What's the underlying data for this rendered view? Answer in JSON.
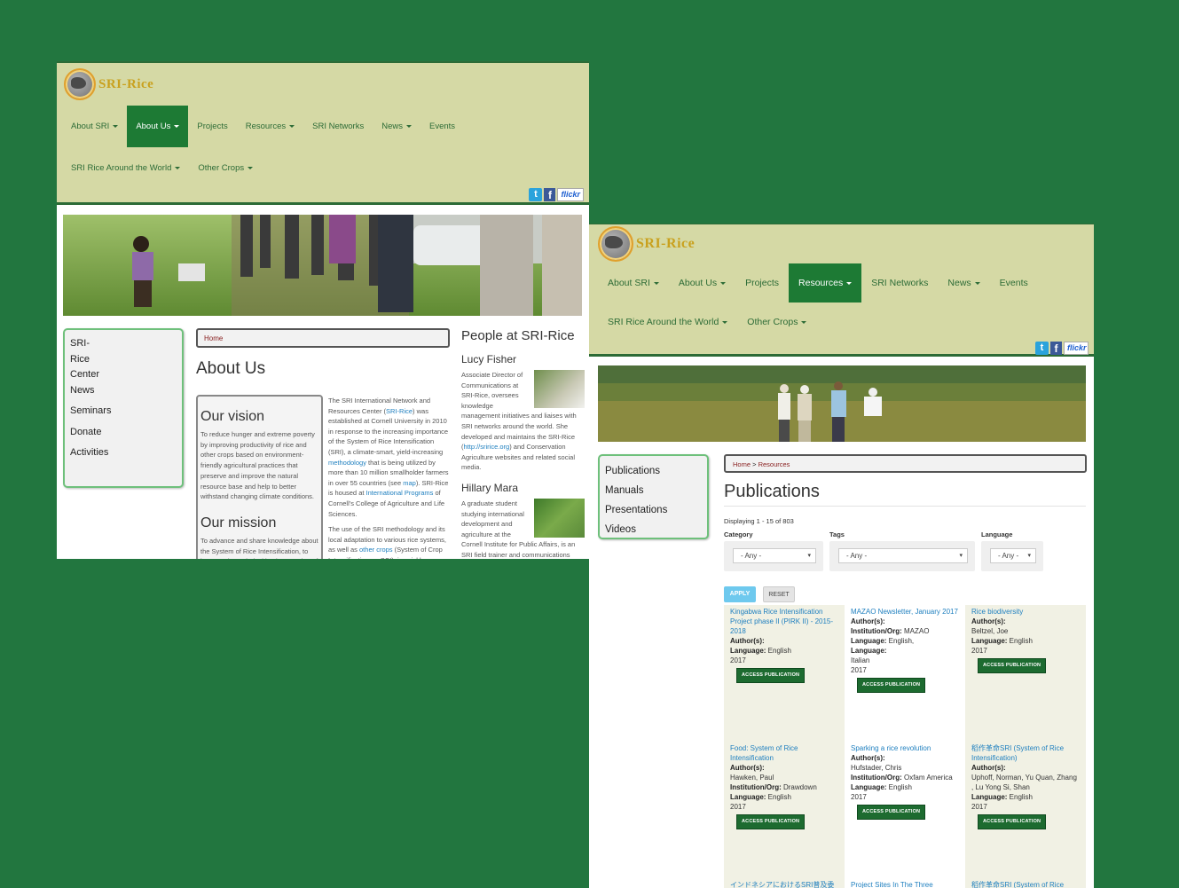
{
  "shotA": {
    "logo": "SRI-Rice",
    "nav": [
      {
        "label": "About SRI",
        "caret": true,
        "active": false
      },
      {
        "label": "About Us",
        "caret": true,
        "active": true
      },
      {
        "label": "Projects",
        "caret": false,
        "active": false
      },
      {
        "label": "Resources",
        "caret": true,
        "active": false
      },
      {
        "label": "SRI Networks",
        "caret": false,
        "active": false
      },
      {
        "label": "News",
        "caret": true,
        "active": false
      },
      {
        "label": "Events",
        "caret": false,
        "active": false
      },
      {
        "label": "SRI Rice Around the World",
        "caret": true,
        "active": false
      },
      {
        "label": "Other Crops",
        "caret": true,
        "active": false
      }
    ],
    "social": {
      "twitter": "t",
      "facebook": "f",
      "flickr": "flickr"
    },
    "sidebar": [
      "SRI-",
      "Rice",
      "Center",
      "News",
      "Seminars",
      "Donate",
      "Activities"
    ],
    "breadcrumb": "Home",
    "title": "About Us",
    "vision": {
      "heading": "Our vision",
      "text": "To reduce hunger and extreme poverty by improving productivity of rice and other crops based on environment-friendly agricultural practices that preserve and improve the natural resource base and help to better withstand changing climate conditions."
    },
    "mission": {
      "heading": "Our mission",
      "text": "To advance and share knowledge about the System of Rice Intensification, to improve the technical implementation of the SRI"
    },
    "intro": {
      "p1a": "The SRI International Network and Resources Center (",
      "p1link1": "SRI-Rice",
      "p1b": ") was established at Cornell University in 2010 in response to the increasing importance of the System of Rice Intensification (SRI), a climate-smart, yield-increasing ",
      "p1link2": "methodology",
      "p1c": " that is being utilized by more than 10 million smallholder farmers in over 55 countries (see ",
      "p1link3": "map",
      "p1d": "). SRI-Rice is housed at ",
      "p1link4": "International Programs",
      "p1e": " of Cornell's College of Agriculture and Life Sciences.",
      "p2a": "The use of the SRI methodology and its local adaptation to various rice systems, as well as ",
      "p2link": "other crops",
      "p2b": " (System of Crop Intensification, or SCI), is quickly spreading among resource-limited farmers in Asia, Africa and Latin"
    },
    "people": {
      "heading": "People at SRI-Rice",
      "p1name": "Lucy Fisher",
      "p1a": "Associate Director of Communications at SRI-Rice, oversees knowledge management initiatives and liaises with SRI networks around the world. She developed and maintains the SRI-Rice (",
      "p1link": "http://sririce.org",
      "p1b": ") and Conservation Agriculture websites and related social media.",
      "p2name": "Hillary Mara",
      "p2": "A graduate student studying international development and agriculture at the Cornell Institute for Public Affairs, is an SRI field trainer and communications assistant"
    }
  },
  "shotB": {
    "logo": "SRI-Rice",
    "nav": [
      {
        "label": "About SRI",
        "caret": true,
        "active": false
      },
      {
        "label": "About Us",
        "caret": true,
        "active": false
      },
      {
        "label": "Projects",
        "caret": false,
        "active": false
      },
      {
        "label": "Resources",
        "caret": true,
        "active": true
      },
      {
        "label": "SRI Networks",
        "caret": false,
        "active": false
      },
      {
        "label": "News",
        "caret": true,
        "active": false
      },
      {
        "label": "Events",
        "caret": false,
        "active": false
      },
      {
        "label": "SRI Rice Around the World",
        "caret": true,
        "active": false
      },
      {
        "label": "Other Crops",
        "caret": true,
        "active": false
      }
    ],
    "social": {
      "twitter": "t",
      "facebook": "f",
      "flickr": "flickr"
    },
    "sidebar": [
      "Publications",
      "Manuals",
      "Presentations",
      "Videos"
    ],
    "breadcrumb_home": "Home",
    "breadcrumb_sep": " > ",
    "breadcrumb_current": "Resources",
    "title": "Publications",
    "displaying": "Displaying 1 - 15 of 803",
    "filters": {
      "category_label": "Category",
      "category_value": "- Any -",
      "tags_label": "Tags",
      "tags_value": "- Any -",
      "language_label": "Language",
      "language_value": "- Any -"
    },
    "apply": "APPLY",
    "reset": "RESET",
    "access_label": "ACCESS PUBLICATION",
    "cards": [
      {
        "title": "Kingabwa Rice Intensification Project phase II (PIRK II) - 2015-2018",
        "lines": [
          [
            "Author(s):",
            ""
          ],
          [
            "Language:",
            " English"
          ],
          [
            "",
            "2017"
          ]
        ]
      },
      {
        "title": "MAZAO Newsletter, January 2017",
        "lines": [
          [
            "Author(s):",
            ""
          ],
          [
            "Institution/Org:",
            " MAZAO"
          ],
          [
            "Language:",
            " English, "
          ],
          [
            "Language:",
            ""
          ],
          [
            "",
            "Italian"
          ],
          [
            "",
            "2017"
          ]
        ]
      },
      {
        "title": "Rice biodiversity",
        "lines": [
          [
            "Author(s):",
            ""
          ],
          [
            "",
            "Beltzel, Joe"
          ],
          [
            "Language:",
            " English"
          ],
          [
            "",
            "2017"
          ]
        ]
      },
      {
        "title": "Food: System of Rice Intensification",
        "lines": [
          [
            "Author(s):",
            ""
          ],
          [
            "",
            "Hawken, Paul"
          ],
          [
            "Institution/Org:",
            " Drawdown"
          ],
          [
            "Language:",
            " English"
          ],
          [
            "",
            "2017"
          ]
        ]
      },
      {
        "title": "Sparking a rice revolution",
        "lines": [
          [
            "Author(s):",
            ""
          ],
          [
            "",
            "Hufstader, Chris"
          ],
          [
            "Institution/Org:",
            " Oxfam America"
          ],
          [
            "Language:",
            " English"
          ],
          [
            "",
            "2017"
          ]
        ]
      },
      {
        "title": "稻作革命SRI (System of Rice Intensification)",
        "lines": [
          [
            "Author(s):",
            ""
          ],
          [
            "",
            "Uphoff, Norman, Yu Quan, Zhang , Lu Yong Si, Shan"
          ],
          [
            "Language:",
            " English"
          ],
          [
            "",
            "2017"
          ]
        ]
      },
      {
        "title": "インドネシアにおけるSRI普及委",
        "lines": []
      },
      {
        "title": "Project Sites In The Three",
        "lines": []
      },
      {
        "title": "稻作革命SRI (System of Rice",
        "lines": []
      }
    ]
  }
}
